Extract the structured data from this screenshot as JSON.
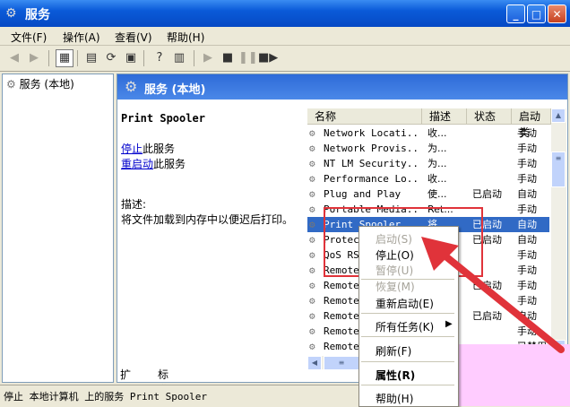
{
  "window": {
    "title": "服务",
    "min": "_",
    "max": "□",
    "close": "✕"
  },
  "menu": [
    "文件(F)",
    "操作(A)",
    "查看(V)",
    "帮助(H)"
  ],
  "tree": {
    "item": "服务 (本地)"
  },
  "right_header": {
    "title": "服务 (本地)"
  },
  "details": {
    "service_name": "Print Spooler",
    "stop_link": "停止",
    "stop_suffix": "此服务",
    "restart_link": "重启动",
    "restart_suffix": "此服务",
    "desc_label": "描述:",
    "desc_text": "将文件加载到内存中以便迟后打印。"
  },
  "columns": [
    "名称",
    "描述",
    "状态",
    "启动类"
  ],
  "rows": [
    {
      "name": "Network Locati...",
      "desc": "收...",
      "status": "",
      "startup": "手动"
    },
    {
      "name": "Network Provis...",
      "desc": "为...",
      "status": "",
      "startup": "手动"
    },
    {
      "name": "NT LM Security...",
      "desc": "为...",
      "status": "",
      "startup": "手动"
    },
    {
      "name": "Performance Lo...",
      "desc": "收...",
      "status": "",
      "startup": "手动"
    },
    {
      "name": "Plug and Play",
      "desc": "使...",
      "status": "已启动",
      "startup": "自动"
    },
    {
      "name": "Portable Media...",
      "desc": "Ret...",
      "status": "",
      "startup": "手动"
    },
    {
      "name": "Print Spooler",
      "desc": "将...",
      "status": "已启动",
      "startup": "自动"
    },
    {
      "name": "Protec",
      "desc": "",
      "status": "已启动",
      "startup": "自动"
    },
    {
      "name": "QoS RS",
      "desc": "",
      "status": "",
      "startup": "手动"
    },
    {
      "name": "Remote",
      "desc": "",
      "status": "",
      "startup": "手动"
    },
    {
      "name": "Remote",
      "desc": "",
      "status": "已启动",
      "startup": "手动"
    },
    {
      "name": "Remote",
      "desc": "",
      "status": "",
      "startup": "手动"
    },
    {
      "name": "Remote",
      "desc": "",
      "status": "已启动",
      "startup": "自动"
    },
    {
      "name": "Remote",
      "desc": "",
      "status": "",
      "startup": "手动"
    },
    {
      "name": "Remote",
      "desc": "",
      "status": "",
      "startup": "已禁用"
    }
  ],
  "tabs": [
    "扩展",
    "标准"
  ],
  "status": "停止 本地计算机 上的服务 Print Spooler",
  "context_menu": {
    "start": "启动(S)",
    "stop": "停止(O)",
    "pause": "暂停(U)",
    "resume": "恢复(M)",
    "restart": "重新启动(E)",
    "all_tasks": "所有任务(K)",
    "refresh": "刷新(F)",
    "properties": "属性(R)",
    "help": "帮助(H)"
  },
  "colors": {
    "title": "#0a5ad8",
    "selection": "#316ac5",
    "highlight": "#e0333a"
  }
}
